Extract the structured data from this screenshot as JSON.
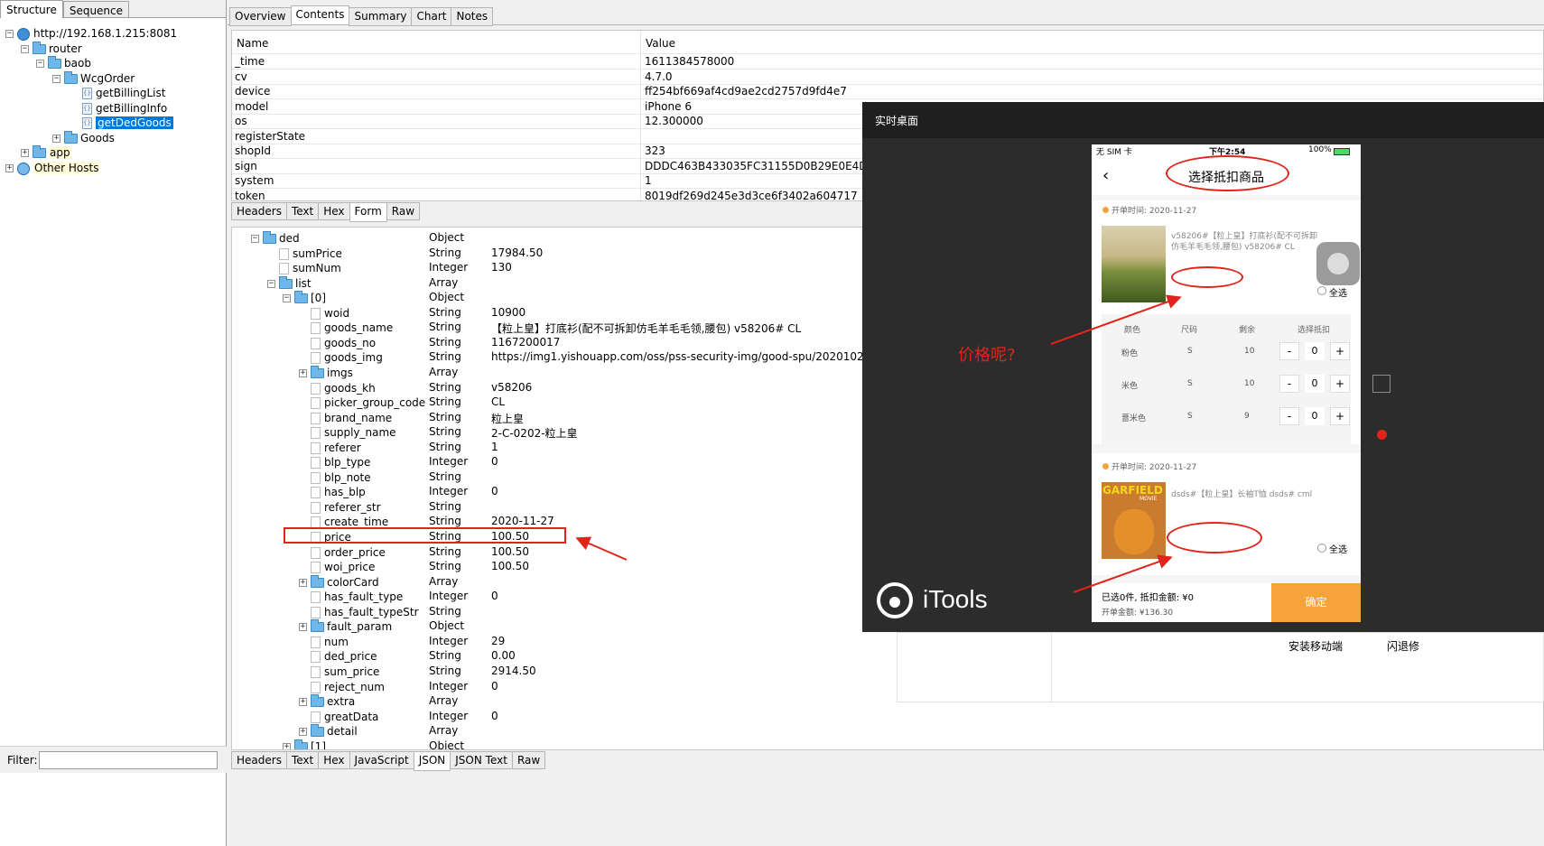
{
  "left_panel": {
    "tabs": [
      "Structure",
      "Sequence"
    ],
    "tree": {
      "host": "http://192.168.1.215:8081",
      "router": "router",
      "baob": "baob",
      "wcgorder": "WcgOrder",
      "f1": "getBillingList",
      "f2": "getBillingInfo",
      "f3": "getDedGoods",
      "goods": "Goods",
      "app": "app",
      "other": "Other Hosts"
    },
    "filter_label": "Filter:"
  },
  "top_tabs": [
    "Overview",
    "Contents",
    "Summary",
    "Chart",
    "Notes"
  ],
  "request_table": {
    "col_name": "Name",
    "col_value": "Value",
    "rows": [
      {
        "name": "_time",
        "value": "1611384578000"
      },
      {
        "name": "cv",
        "value": "4.7.0"
      },
      {
        "name": "device",
        "value": "ff254bf669af4cd9ae2cd2757d9fd4e7"
      },
      {
        "name": "model",
        "value": "iPhone 6"
      },
      {
        "name": "os",
        "value": "12.300000"
      },
      {
        "name": "registerState",
        "value": ""
      },
      {
        "name": "shopId",
        "value": "323"
      },
      {
        "name": "sign",
        "value": "DDDC463B433035FC31155D0B29E0E4D4"
      },
      {
        "name": "system",
        "value": "1"
      },
      {
        "name": "token",
        "value": "8019df269d245e3d3ce6f3402a604717"
      }
    ]
  },
  "mid_tabs": [
    "Headers",
    "Text",
    "Hex",
    "Form",
    "Raw"
  ],
  "json_tree": [
    {
      "name": "ded",
      "type": "Object",
      "value": ""
    },
    {
      "name": "sumPrice",
      "type": "String",
      "value": "17984.50"
    },
    {
      "name": "sumNum",
      "type": "Integer",
      "value": "130"
    },
    {
      "name": "list",
      "type": "Array",
      "value": ""
    },
    {
      "name": "[0]",
      "type": "Object",
      "value": ""
    },
    {
      "name": "woid",
      "type": "String",
      "value": "10900"
    },
    {
      "name": "goods_name",
      "type": "String",
      "value": "【粒上皇】打底衫(配不可拆卸仿毛羊毛毛领,腰包)  v58206#  CL"
    },
    {
      "name": "goods_no",
      "type": "String",
      "value": "1167200017"
    },
    {
      "name": "goods_img",
      "type": "String",
      "value": "https://img1.yishouapp.com/oss/pss-security-img/good-spu/20201023/e1044"
    },
    {
      "name": "imgs",
      "type": "Array",
      "value": ""
    },
    {
      "name": "goods_kh",
      "type": "String",
      "value": "v58206"
    },
    {
      "name": "picker_group_code",
      "type": "String",
      "value": "CL"
    },
    {
      "name": "brand_name",
      "type": "String",
      "value": "粒上皇"
    },
    {
      "name": "supply_name",
      "type": "String",
      "value": "2-C-0202-粒上皇"
    },
    {
      "name": "referer",
      "type": "String",
      "value": "1"
    },
    {
      "name": "blp_type",
      "type": "Integer",
      "value": "0"
    },
    {
      "name": "blp_note",
      "type": "String",
      "value": ""
    },
    {
      "name": "has_blp",
      "type": "Integer",
      "value": "0"
    },
    {
      "name": "referer_str",
      "type": "String",
      "value": ""
    },
    {
      "name": "create_time",
      "type": "String",
      "value": "2020-11-27"
    },
    {
      "name": "price",
      "type": "String",
      "value": "100.50"
    },
    {
      "name": "order_price",
      "type": "String",
      "value": "100.50"
    },
    {
      "name": "woi_price",
      "type": "String",
      "value": "100.50"
    },
    {
      "name": "colorCard",
      "type": "Array",
      "value": ""
    },
    {
      "name": "has_fault_type",
      "type": "Integer",
      "value": "0"
    },
    {
      "name": "has_fault_typeStr",
      "type": "String",
      "value": ""
    },
    {
      "name": "fault_param",
      "type": "Object",
      "value": ""
    },
    {
      "name": "num",
      "type": "Integer",
      "value": "29"
    },
    {
      "name": "ded_price",
      "type": "String",
      "value": "0.00"
    },
    {
      "name": "sum_price",
      "type": "String",
      "value": "2914.50"
    },
    {
      "name": "reject_num",
      "type": "Integer",
      "value": "0"
    },
    {
      "name": "extra",
      "type": "Array",
      "value": ""
    },
    {
      "name": "greatData",
      "type": "Integer",
      "value": "0"
    },
    {
      "name": "detail",
      "type": "Array",
      "value": ""
    },
    {
      "name": "[1]",
      "type": "Object",
      "value": ""
    }
  ],
  "bottom_tabs": [
    "Headers",
    "Text",
    "Hex",
    "JavaScript",
    "JSON",
    "JSON Text",
    "Raw"
  ],
  "desktop_window": {
    "title": "实时桌面",
    "brand": "iTools",
    "behind_text_1": "安装移动端",
    "behind_text_2": "闪退修"
  },
  "phone": {
    "status_left": "无 SIM 卡",
    "status_time": "下午2:54",
    "status_battery": "100%",
    "page_title": "选择抵扣商品",
    "order1": {
      "time": "开单时间: 2020-11-27",
      "title": "v58206#【粒上皇】打底衫(配不可拆卸仿毛羊毛毛领,腰包)  v58206#  CL",
      "select_all": "全选",
      "headers": [
        "颜色",
        "尺码",
        "剩余",
        "选择抵扣"
      ],
      "rows": [
        {
          "color": "粉色",
          "size": "S",
          "left": "10",
          "qty": "0"
        },
        {
          "color": "米色",
          "size": "S",
          "left": "10",
          "qty": "0"
        },
        {
          "color": "薏米色",
          "size": "S",
          "left": "9",
          "qty": "0"
        }
      ],
      "minus": "-",
      "plus": "+"
    },
    "order2": {
      "time": "开单时间: 2020-11-27",
      "title": "dsds#【粒上皇】长袖T恤  dsds#  cml",
      "select_all": "全选",
      "img_text": "GARFIELD",
      "img_sub": "MOVIE"
    },
    "footer_selected": "已选0件, 抵扣金额: ¥0",
    "footer_total": "开单金额: ¥136.30",
    "confirm": "确定"
  },
  "annotation": {
    "question": "价格呢?"
  },
  "colors": {
    "accent_red": "#e0241b",
    "confirm_orange": "#f6a43a",
    "selection_blue": "#0078d7"
  }
}
